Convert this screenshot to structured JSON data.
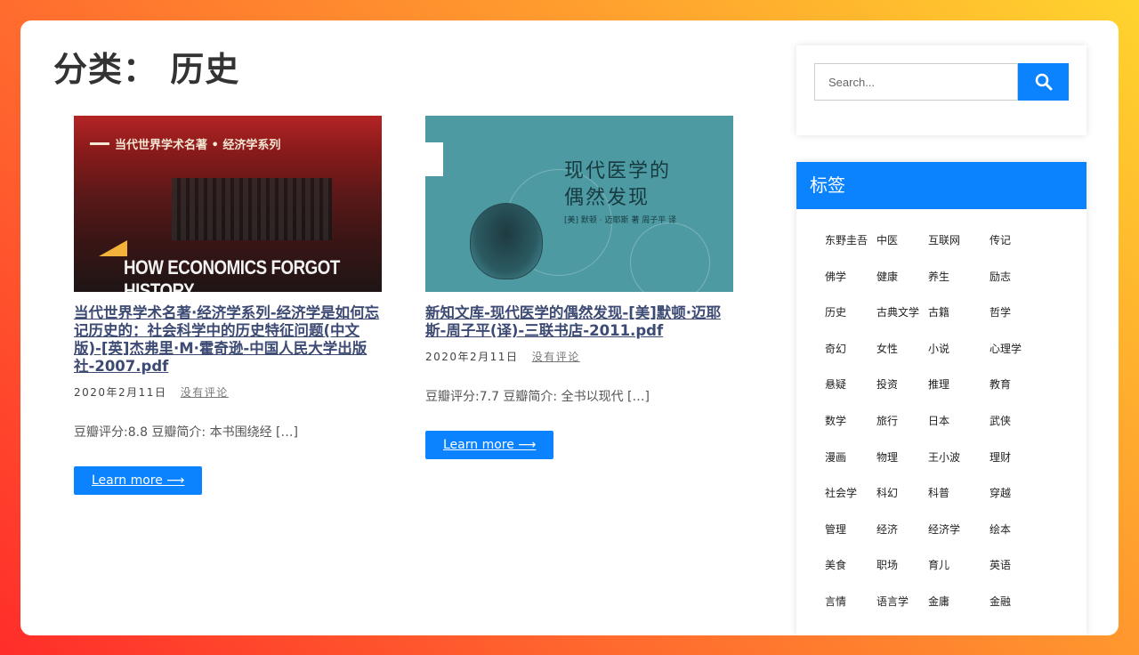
{
  "page": {
    "title": "分类： 历史"
  },
  "posts": [
    {
      "cover": {
        "series": "当代世界学术名著 • 经济学系列",
        "english_title": "HOW ECONOMICS FORGOT HISTORY"
      },
      "title": "当代世界学术名著·经济学系列-经济学是如何忘记历史的：社会科学中的历史特征问题(中文版)-[英]杰弗里·M·霍奇逊-中国人民大学出版社-2007.pdf",
      "date": "2020年2月11日",
      "comments": "没有评论",
      "excerpt": "豆瓣评分:8.8 豆瓣简介: 本书围绕经 […]",
      "button": "Learn more ⟶"
    },
    {
      "cover": {
        "title_line1": "现代医学的",
        "title_line2": "偶然发现",
        "author": "[美] 默顿 · 迈耶斯  著   周子平  译"
      },
      "title": "新知文库-现代医学的偶然发现-[美]默顿·迈耶斯-周子平(译)-三联书店-2011.pdf",
      "date": "2020年2月11日",
      "comments": "没有评论",
      "excerpt": "豆瓣评分:7.7 豆瓣简介: 全书以现代 […]",
      "button": "Learn more ⟶"
    }
  ],
  "search": {
    "placeholder": "Search..."
  },
  "tags": {
    "title": "标签",
    "items": [
      "东野圭吾",
      "中医",
      "互联网",
      "传记",
      "佛学",
      "健康",
      "养生",
      "励志",
      "历史",
      "古典文学",
      "古籍",
      "哲学",
      "奇幻",
      "女性",
      "小说",
      "心理学",
      "悬疑",
      "投资",
      "推理",
      "教育",
      "数学",
      "旅行",
      "日本",
      "武侠",
      "漫画",
      "物理",
      "王小波",
      "理财",
      "社会学",
      "科幻",
      "科普",
      "穿越",
      "管理",
      "经济",
      "经济学",
      "绘本",
      "美食",
      "职场",
      "育儿",
      "英语",
      "言情",
      "语言学",
      "金庸",
      "金融"
    ]
  },
  "colors": {
    "accent": "#0b83ff",
    "title_link": "#3d4a73"
  }
}
